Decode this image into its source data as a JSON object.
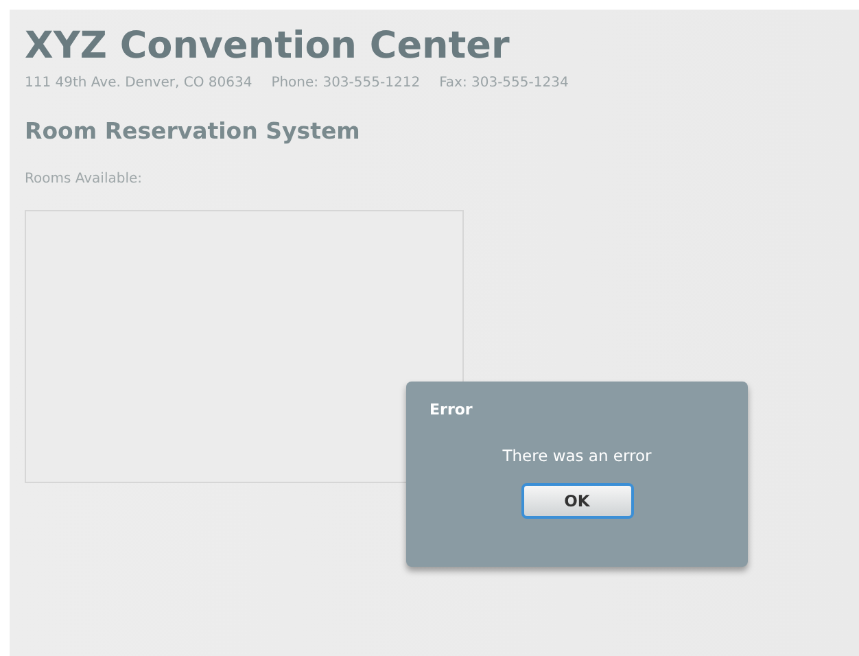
{
  "header": {
    "title": "XYZ Convention Center",
    "address": "111 49th Ave. Denver, CO 80634",
    "phone": "Phone: 303-555-1212",
    "fax": "Fax: 303-555-1234"
  },
  "section_title": "Room Reservation System",
  "rooms_label": "Rooms Available:",
  "dialog": {
    "title": "Error",
    "message": "There was an error",
    "buttons": [
      "OK"
    ]
  }
}
